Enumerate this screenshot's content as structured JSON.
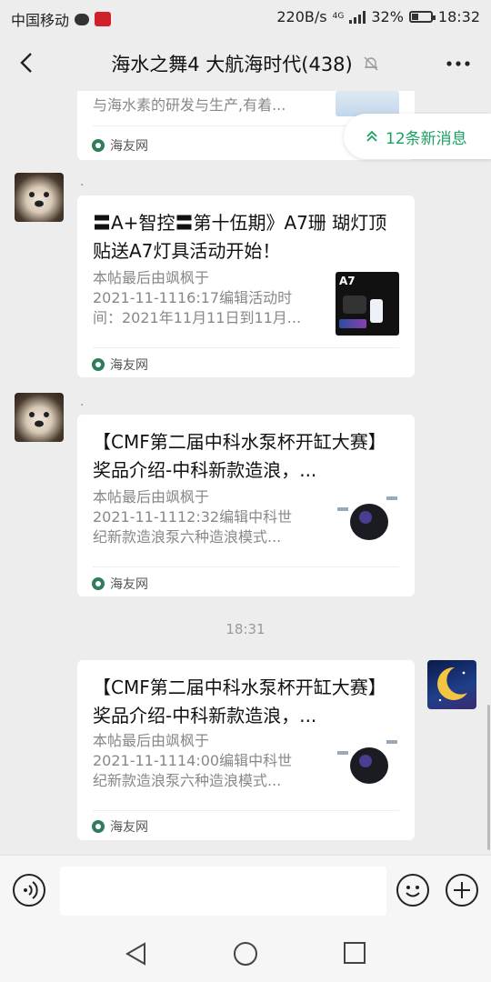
{
  "status_bar": {
    "carrier": "中国移动",
    "net_speed": "220B/s",
    "net_type": "4G",
    "battery_percent": "32%",
    "battery_level": 0.32,
    "time": "18:32"
  },
  "header": {
    "title": "海水之舞4 大航海时代(438)",
    "back_icon": "back-chevron-icon",
    "mute_icon": "bell-muted-icon",
    "more_icon": "more-dots-icon"
  },
  "new_messages": {
    "label": "12条新消息",
    "icon": "double-chevron-up-icon",
    "color": "#1aa260"
  },
  "messages": [
    {
      "type": "link-card-partial",
      "desc": "与海水素的研发与生产,有着...",
      "source": "海友网"
    },
    {
      "type": "link-card",
      "sender": ".",
      "title": "〓A+智控〓第十伍期》A7珊 瑚灯顶贴送A7灯具活动开始！",
      "desc_lines": [
        "本帖最后由飒枫于",
        "2021-11-1116:17编辑活动时",
        "间：2021年11月11日到11月..."
      ],
      "thumb_label": "A7",
      "source": "海友网"
    },
    {
      "type": "link-card",
      "sender": ".",
      "title": "【CMF第二届中科水泵杯开缸大赛】奖品介绍-中科新款造浪，...",
      "desc_lines": [
        "本帖最后由飒枫于",
        "2021-11-1112:32编辑中科世",
        "纪新款造浪泵六种造浪模式..."
      ],
      "source": "海友网"
    },
    {
      "type": "timestamp",
      "text": "18:31"
    },
    {
      "type": "link-card-self",
      "title": "【CMF第二届中科水泵杯开缸大赛】奖品介绍-中科新款造浪，...",
      "desc_lines": [
        "本帖最后由飒枫于",
        "2021-11-1114:00编辑中科世",
        "纪新款造浪泵六种造浪模式..."
      ],
      "source": "海友网"
    }
  ],
  "input_bar": {
    "voice_icon": "voice-icon",
    "emoji_icon": "emoji-icon",
    "plus_icon": "plus-icon",
    "text_value": ""
  },
  "nav_bar": {
    "back_icon": "nav-back-icon",
    "home_icon": "nav-home-icon",
    "recent_icon": "nav-recent-icon"
  }
}
